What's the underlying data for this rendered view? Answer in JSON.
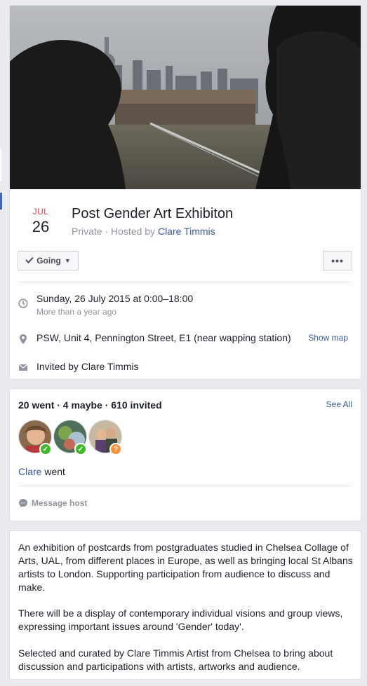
{
  "event": {
    "month": "JUL",
    "day": "26",
    "title": "Post Gender Art Exhibiton",
    "privacy": "Private",
    "separator": " · Hosted by ",
    "host": "Clare Timmis"
  },
  "actions": {
    "going_label": "Going",
    "more_label": "•••"
  },
  "details": {
    "datetime": "Sunday, 26 July 2015 at 0:00–18:00",
    "relative_time": "More than a year ago",
    "location": "PSW, Unit 4, Pennington Street, E1 (near wapping station)",
    "show_map": "Show map",
    "invited_by": "Invited by Clare Timmis"
  },
  "guests": {
    "summary": "20 went · 4 maybe · 610 invited",
    "see_all": "See All",
    "went_name": "Clare",
    "went_suffix": " went",
    "message_host": "Message host",
    "statuses": [
      "went",
      "went",
      "maybe"
    ]
  },
  "description": {
    "paragraphs": [
      "An exhibition of postcards from postgraduates studied in Chelsea Collage of Arts, UAL, from different places in Europe, as well as bringing local St Albans artists to London. Supporting participation from audience to discuss and make.",
      "There will be a display of contemporary individual visions and group views, expressing important issues around 'Gender' today'.",
      "Selected and curated by Clare Timmis Artist from Chelsea to bring about discussion and participations with artists, artworks and audience."
    ]
  },
  "colors": {
    "accent": "#365899",
    "month_red": "#e0393e",
    "went_green": "#42b72a",
    "maybe_orange": "#f7923b"
  }
}
